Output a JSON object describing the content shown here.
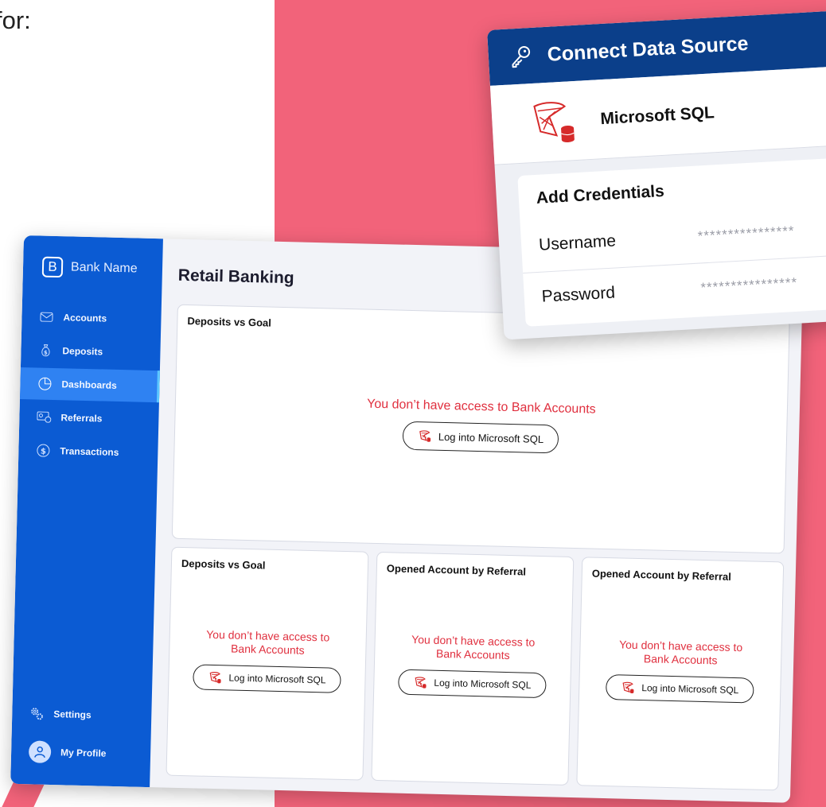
{
  "intro": {
    "text": "for:"
  },
  "app": {
    "brand": {
      "logo_letter": "B",
      "name": "Bank Name"
    },
    "nav": [
      {
        "label": "Accounts",
        "icon": "envelope-icon"
      },
      {
        "label": "Deposits",
        "icon": "money-bag-icon"
      },
      {
        "label": "Dashboards",
        "icon": "pie-chart-icon",
        "active": true
      },
      {
        "label": "Referrals",
        "icon": "referral-card-icon"
      },
      {
        "label": "Transactions",
        "icon": "dollar-circle-icon"
      }
    ],
    "nav_bottom": [
      {
        "label": "Settings",
        "icon": "gear-icon"
      },
      {
        "label": "My Profile",
        "icon": "avatar-icon"
      }
    ],
    "page_title": "Retail Banking",
    "cards": [
      {
        "title": "Deposits vs Goal",
        "message": "You don’t have access to Bank Accounts",
        "button": "Log into Microsoft SQL"
      },
      {
        "title": "Deposits vs Goal",
        "message": "You don’t have access to Bank Accounts",
        "button": "Log into Microsoft SQL"
      },
      {
        "title": "Opened Account by Referral",
        "message": "You don’t have access to Bank Accounts",
        "button": "Log into Microsoft SQL"
      },
      {
        "title": "Opened Account by Referral",
        "message": "You don’t have access to Bank Accounts",
        "button": "Log into Microsoft SQL"
      }
    ]
  },
  "modal": {
    "title": "Connect Data Source",
    "source_name": "Microsoft SQL",
    "credentials_title": "Add Credentials",
    "fields": [
      {
        "label": "Username",
        "value": "****************"
      },
      {
        "label": "Password",
        "value": "****************"
      }
    ]
  },
  "colors": {
    "accent_pink": "#f2637a",
    "sidebar_blue": "#0b5bd3",
    "active_nav": "#2f82f2",
    "modal_header": "#0b3f8a",
    "error_red": "#e0303f"
  }
}
